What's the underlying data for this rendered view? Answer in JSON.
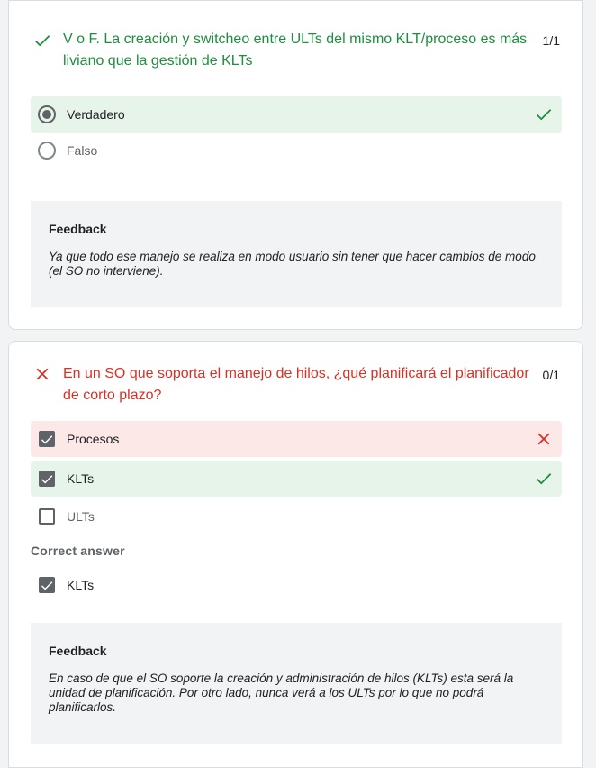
{
  "questions": [
    {
      "status": "correct",
      "title": "V o F. La creación y switcheo entre ULTs del mismo KLT/proceso es más liviano que la gestión de KLTs",
      "score": "1/1",
      "options": [
        {
          "label": "Verdadero",
          "selected": true,
          "result": "correct"
        },
        {
          "label": "Falso",
          "selected": false,
          "result": "none"
        }
      ],
      "feedback": {
        "title": "Feedback",
        "text": "Ya que todo ese manejo se realiza en modo usuario sin tener que hacer cambios de modo (el SO no interviene)."
      }
    },
    {
      "status": "incorrect",
      "title": "En un SO que soporta el manejo de hilos, ¿qué planificará el planificador de corto plazo?",
      "score": "0/1",
      "options": [
        {
          "label": "Procesos",
          "selected": true,
          "result": "wrong"
        },
        {
          "label": "KLTs",
          "selected": true,
          "result": "correct"
        },
        {
          "label": "ULTs",
          "selected": false,
          "result": "none"
        }
      ],
      "correct_answer_label": "Correct answer",
      "correct_answers": [
        {
          "label": "KLTs",
          "selected": true
        }
      ],
      "feedback": {
        "title": "Feedback",
        "text": "En caso de que el SO soporte la creación y administración de hilos (KLTs) esta será la unidad de planificación. Por otro lado, nunca verá a los ULTs por lo que no podrá planificarlos."
      }
    }
  ],
  "colors": {
    "correct_green": "#1e8e3e",
    "wrong_red": "#d93025",
    "correct_bg": "#e6f4ea",
    "wrong_bg": "#fce8e6",
    "feedback_bg": "#f1f3f4"
  },
  "icons": {
    "correct": "check-icon",
    "wrong": "close-icon"
  }
}
